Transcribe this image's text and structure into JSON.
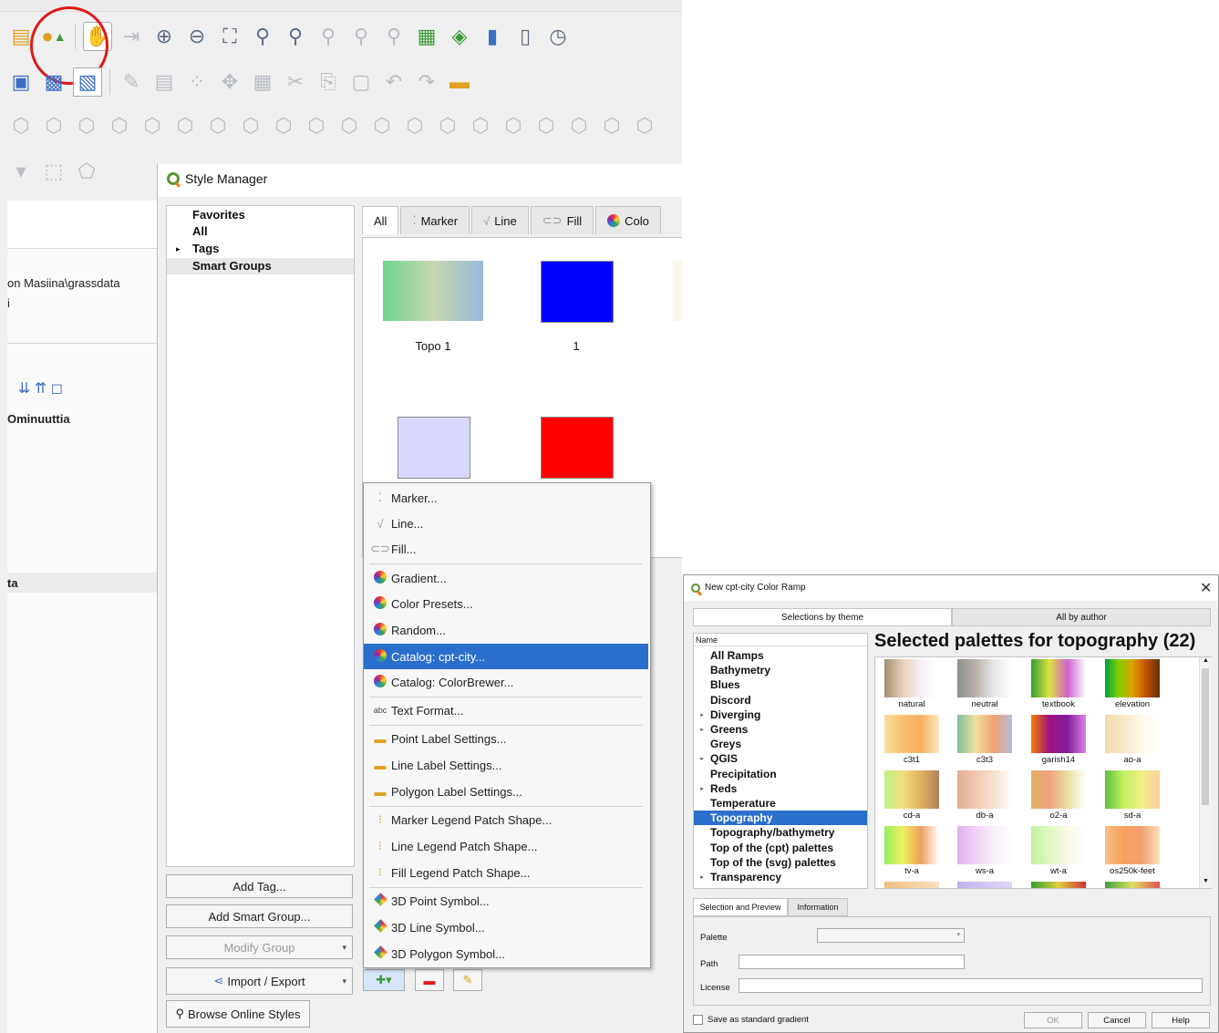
{
  "qgis_bg": {
    "menu_partial": "",
    "path_text": "on Masiina\\grassdata",
    "small_text": "i",
    "ominuuttia": "Ominuuttia",
    "ta": "ta",
    "icons_row1": [
      "new-print-layout-icon",
      "style-manager-icon",
      "pan-icon",
      "pan-to-selection-icon",
      "zoom-in-icon",
      "zoom-out-icon",
      "zoom-full-icon",
      "zoom-selection-icon",
      "zoom-layer-icon",
      "zoom-native-icon",
      "zoom-last-icon",
      "zoom-next-icon",
      "new-map-view-icon",
      "new-3d-map-view-icon",
      "new-bookmark-icon",
      "show-bookmarks-icon",
      "temporal-controller-icon"
    ],
    "icons_row2": [
      "add-layer-icon",
      "raster-icon",
      "digitize-icon",
      "edit-pencil-icon",
      "save-edits-icon",
      "add-feature-icon",
      "vertex-tool-icon",
      "delete-icon",
      "cut-icon",
      "copy-icon",
      "paste-icon",
      "undo-icon",
      "redo-icon",
      "label-icon"
    ]
  },
  "style_manager": {
    "title": "Style Manager",
    "tree": {
      "favorites": "Favorites",
      "all": "All",
      "tags": "Tags",
      "smart_groups": "Smart Groups"
    },
    "buttons": {
      "add_tag": "Add Tag...",
      "add_smart_group": "Add Smart Group...",
      "modify_group": "Modify Group",
      "import_export": "Import / Export",
      "browse_online": "Browse Online Styles"
    },
    "tabs": [
      "All",
      "Marker",
      "Line",
      "Fill",
      "Colo"
    ],
    "items": [
      {
        "label": "Topo 1",
        "color": "gradient-topo"
      },
      {
        "label": "1",
        "color": "#0000ff"
      },
      {
        "label": "",
        "color": "#d8d8ff"
      },
      {
        "label": "",
        "color": "#ff0000"
      }
    ],
    "context_menu": {
      "items": [
        {
          "label": "Marker...",
          "icon": "marker-icon"
        },
        {
          "label": "Line...",
          "icon": "line-icon"
        },
        {
          "label": "Fill...",
          "icon": "fill-icon"
        },
        {
          "label": "Gradient...",
          "icon": "color-wheel-icon"
        },
        {
          "label": "Color Presets...",
          "icon": "color-wheel-icon"
        },
        {
          "label": "Random...",
          "icon": "color-wheel-icon"
        },
        {
          "label": "Catalog: cpt-city...",
          "icon": "color-wheel-icon",
          "selected": true
        },
        {
          "label": "Catalog: ColorBrewer...",
          "icon": "color-wheel-icon"
        },
        {
          "label": "Text Format...",
          "icon": "text-format-icon"
        },
        {
          "label": "Point Label Settings...",
          "icon": "label-icon"
        },
        {
          "label": "Line Label Settings...",
          "icon": "label-icon"
        },
        {
          "label": "Polygon Label Settings...",
          "icon": "label-icon"
        },
        {
          "label": "Marker Legend Patch Shape...",
          "icon": "legend-icon"
        },
        {
          "label": "Line Legend Patch Shape...",
          "icon": "legend-icon"
        },
        {
          "label": "Fill Legend Patch Shape...",
          "icon": "legend-icon"
        },
        {
          "label": "3D Point Symbol...",
          "icon": "3d-icon"
        },
        {
          "label": "3D Line Symbol...",
          "icon": "3d-icon"
        },
        {
          "label": "3D Polygon Symbol...",
          "icon": "3d-icon"
        }
      ]
    }
  },
  "cpt_dialog": {
    "title": "New cpt-city Color Ramp",
    "tab_theme": "Selections by theme",
    "tab_author": "All by author",
    "list_header": "Name",
    "list_items": [
      {
        "label": "All Ramps",
        "arrow": false
      },
      {
        "label": "Bathymetry",
        "arrow": false
      },
      {
        "label": "Blues",
        "arrow": false
      },
      {
        "label": "Discord",
        "arrow": false
      },
      {
        "label": "Diverging",
        "arrow": true
      },
      {
        "label": "Greens",
        "arrow": true
      },
      {
        "label": "Greys",
        "arrow": false
      },
      {
        "label": "QGIS",
        "arrow": true
      },
      {
        "label": "Precipitation",
        "arrow": false
      },
      {
        "label": "Reds",
        "arrow": true
      },
      {
        "label": "Temperature",
        "arrow": false
      },
      {
        "label": "Topography",
        "arrow": false,
        "selected": true
      },
      {
        "label": "Topography/bathymetry",
        "arrow": false
      },
      {
        "label": "Top of the (cpt) palettes",
        "arrow": false
      },
      {
        "label": "Top of the (svg) palettes",
        "arrow": false
      },
      {
        "label": "Transparency",
        "arrow": true
      }
    ],
    "heading": "Selected palettes for topography (22)",
    "ramps": [
      {
        "label": "natural",
        "colors": [
          "#a09070",
          "#e8d0b8",
          "#f8f0f8",
          "#ffffff"
        ]
      },
      {
        "label": "neutral",
        "colors": [
          "#909090",
          "#b8b0a8",
          "#e8e8e8",
          "#ffffff"
        ]
      },
      {
        "label": "textbook",
        "colors": [
          "#30a030",
          "#e0e040",
          "#d060d0",
          "#ffffff"
        ]
      },
      {
        "label": "elevation",
        "colors": [
          "#00a040",
          "#80d000",
          "#e0a000",
          "#c05000",
          "#603010"
        ]
      },
      {
        "label": "c3t1",
        "colors": [
          "#f8e0a0",
          "#f8c070",
          "#f8b060",
          "#fce8c0"
        ]
      },
      {
        "label": "c3t3",
        "colors": [
          "#80c0a0",
          "#f0e0a0",
          "#f0a070",
          "#b0c0e0"
        ]
      },
      {
        "label": "garish14",
        "colors": [
          "#f08000",
          "#a01080",
          "#8020a0",
          "#e080e0"
        ]
      },
      {
        "label": "ao-a",
        "colors": [
          "#f0d8a8",
          "#f8e8c8",
          "#fff8e8",
          "#ffffff"
        ]
      },
      {
        "label": "cd-a",
        "colors": [
          "#c0f080",
          "#f0e080",
          "#e0b060",
          "#b08060"
        ]
      },
      {
        "label": "db-a",
        "colors": [
          "#e0b090",
          "#f0c8b0",
          "#f8e0d0",
          "#ffffff"
        ]
      },
      {
        "label": "o2-a",
        "colors": [
          "#e0b060",
          "#f0a080",
          "#e8e0a0",
          "#ffffff"
        ]
      },
      {
        "label": "sd-a",
        "colors": [
          "#60c040",
          "#c0f060",
          "#f0f080",
          "#f8d0a0"
        ]
      },
      {
        "label": "tv-a",
        "colors": [
          "#90f060",
          "#f0f060",
          "#f0a060",
          "#ffffff"
        ]
      },
      {
        "label": "ws-a",
        "colors": [
          "#e0b0f0",
          "#f0d0f8",
          "#f8f0f8",
          "#ffffff"
        ]
      },
      {
        "label": "wt-a",
        "colors": [
          "#c0f0a0",
          "#e0f8c0",
          "#f8f8e8",
          "#ffffff"
        ]
      },
      {
        "label": "os250k-feet",
        "colors": [
          "#f8c080",
          "#f8a060",
          "#f0a070",
          "#ffe0c0"
        ]
      }
    ],
    "sub_tabs": [
      "Selection and Preview",
      "Information"
    ],
    "palette_label": "Palette",
    "path_label": "Path",
    "license_label": "License",
    "save_checkbox": "Save as standard gradient",
    "ok": "OK",
    "cancel": "Cancel",
    "help": "Help"
  }
}
